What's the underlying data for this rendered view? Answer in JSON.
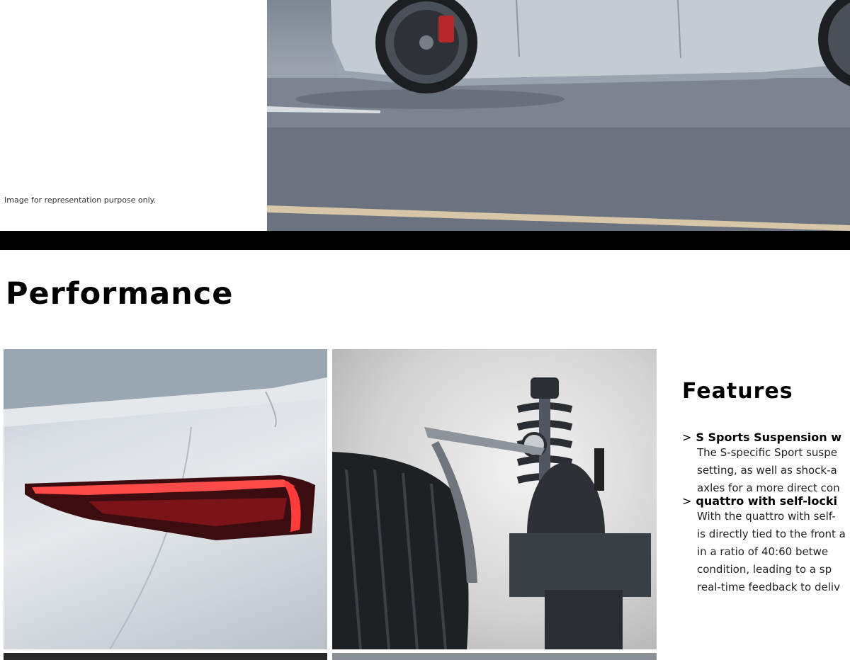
{
  "hero": {
    "caption": "Image for representation purpose only."
  },
  "performance": {
    "title": "Performance"
  },
  "features": {
    "title": "Features",
    "items": [
      {
        "title": "S Sports Suspension w",
        "lines": [
          "The S-specific Sport suspe",
          "setting, as well as shock-a",
          "axles for a more direct con"
        ]
      },
      {
        "title": "quattro with self-locki",
        "lines": [
          "With the quattro with self-",
          "is directly tied to the front a",
          "in a ratio of 40:60 betwe",
          "condition, leading to a sp",
          "real-time feedback to deliv"
        ]
      }
    ]
  },
  "colors": {
    "background": "#ffffff",
    "band": "#000000",
    "text": "#000000"
  }
}
